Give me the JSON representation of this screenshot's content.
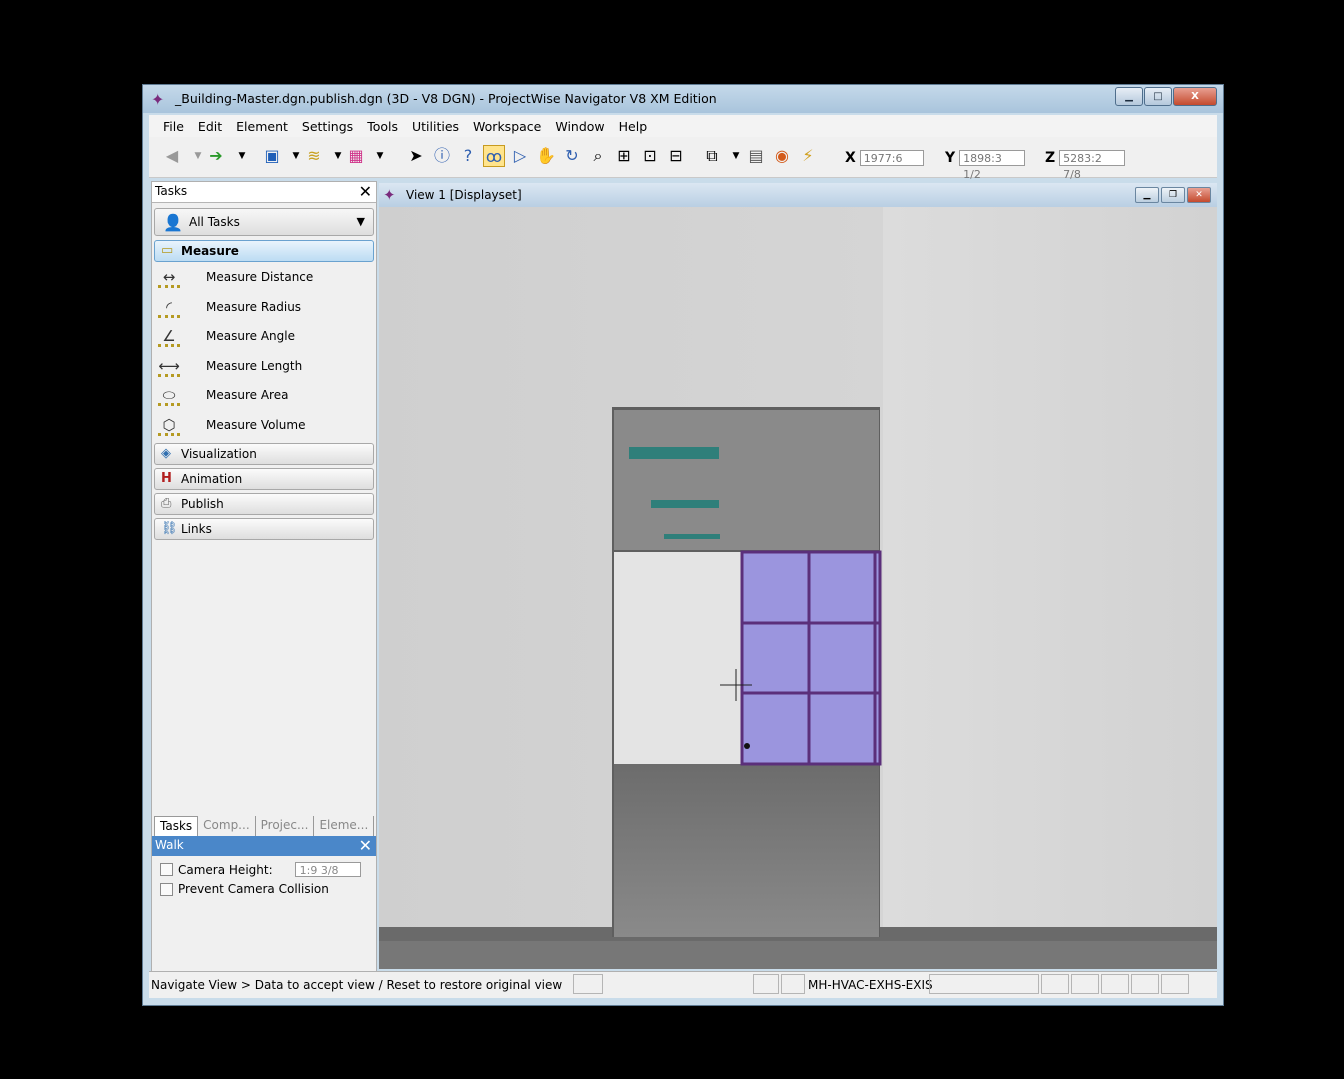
{
  "window": {
    "title": "_Building-Master.dgn.publish.dgn (3D - V8 DGN) - ProjectWise Navigator V8 XM Edition",
    "minimize": "▁",
    "maximize": "□",
    "close": "X"
  },
  "menu": [
    "File",
    "Edit",
    "Element",
    "Settings",
    "Tools",
    "Utilities",
    "Workspace",
    "Window",
    "Help"
  ],
  "coords": {
    "x_label": "X",
    "x_value": "1977:6",
    "y_label": "Y",
    "y_value": "1898:3 1/2",
    "z_label": "Z",
    "z_value": "5283:2 7/8"
  },
  "tasks_panel": {
    "title": "Tasks",
    "close": "✕",
    "dropdown": "All Tasks",
    "active_section": "Measure",
    "items": [
      {
        "label": "Measure Distance",
        "icon": "measure-distance-icon"
      },
      {
        "label": "Measure Radius",
        "icon": "measure-radius-icon"
      },
      {
        "label": "Measure Angle",
        "icon": "measure-angle-icon"
      },
      {
        "label": "Measure Length",
        "icon": "measure-length-icon"
      },
      {
        "label": "Measure Area",
        "icon": "measure-area-icon"
      },
      {
        "label": "Measure Volume",
        "icon": "measure-volume-icon"
      }
    ],
    "sections": [
      "Visualization",
      "Animation",
      "Publish",
      "Links"
    ],
    "tabs": [
      "Tasks",
      "Comp...",
      "Projec...",
      "Eleme..."
    ]
  },
  "walk_panel": {
    "title": "Walk",
    "close": "✕",
    "camera_height_label": "Camera Height:",
    "camera_height_value": "1:9 3/8",
    "prevent_collision_label": "Prevent Camera Collision"
  },
  "view": {
    "title": "View 1 [Displayset]"
  },
  "statusbar": {
    "message": "Navigate View > Data to accept view / Reset to restore original view",
    "level": "MH-HVAC-EXHS-EXIS"
  },
  "colors": {
    "wall_light": "#d8d8d8",
    "floor_gray": "#7e7e7e",
    "window_purple": "#9b95de",
    "window_frame": "#5b2f7a"
  }
}
